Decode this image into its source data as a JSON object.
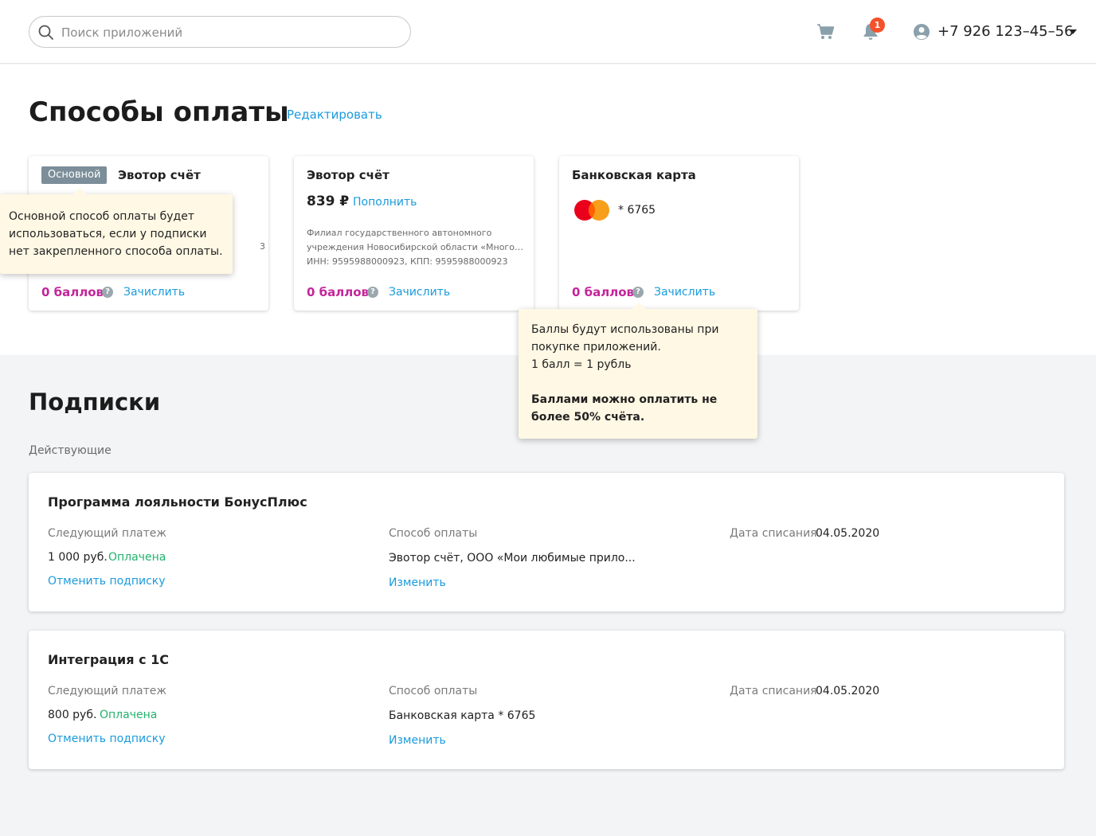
{
  "header": {
    "search_placeholder": "Поиск приложений",
    "notifications_count": "1",
    "phone": "+7 926 123–45–56"
  },
  "payment": {
    "title": "Способы оплаты",
    "edit_label": "Редактировать",
    "cards": [
      {
        "badge": "Основной",
        "title": "Эвотор счёт",
        "hidden_fragment": "3",
        "points": "0 баллов",
        "credit_label": "Зачислить"
      },
      {
        "title": "Эвотор счёт",
        "amount": "839 ₽",
        "topup_label": "Пополнить",
        "org_line1": "Филиал государственного автономного",
        "org_line2": "учреждения Новосибирской области «Многофункциональный центр",
        "org_line3": "ИНН: 9595988000923, КПП: 9595988000923",
        "points": "0 баллов",
        "credit_label": "Зачислить"
      },
      {
        "title": "Банковская карта",
        "card_number": "* 6765",
        "points": "0 баллов",
        "credit_label": "Зачислить"
      }
    ],
    "tooltip_main": "Основной способ оплаты будет использоваться, если у подписки нет закрепленного способа оплаты.",
    "tooltip_points": {
      "line1": "Баллы будут использованы при покупке приложений.",
      "line2": "1 балл = 1 рубль",
      "bold": "Баллами можно оплатить не более 50% счёта."
    }
  },
  "subscriptions": {
    "title": "Подписки",
    "active_label": "Действующие",
    "items": [
      {
        "name": "Программа лояльности БонусПлюс",
        "next_payment_label": "Следующий платеж",
        "amount": "1 000 руб.",
        "status": "Оплачена",
        "cancel_label": "Отменить подписку",
        "method_label": "Способ оплаты",
        "method_value": "Эвотор счёт, ООО «Мои любимые прило...",
        "change_label": "Изменить",
        "date_label": "Дата списания",
        "date_value": "04.05.2020"
      },
      {
        "name": "Интеграция с 1С",
        "next_payment_label": "Следующий платеж",
        "amount": "800 руб.",
        "status": "Оплачена",
        "cancel_label": "Отменить подписку",
        "method_label": "Способ оплаты",
        "method_value": "Банковская карта * 6765",
        "change_label": "Изменить",
        "date_label": "Дата списания",
        "date_value": "04.05.2020"
      }
    ]
  },
  "colors": {
    "link": "#1a9bdc",
    "points": "#c4259a",
    "paid": "#21b36c",
    "badge": "#7b8e99",
    "tooltip_bg": "#fff8e4",
    "notification": "#f5512b"
  }
}
